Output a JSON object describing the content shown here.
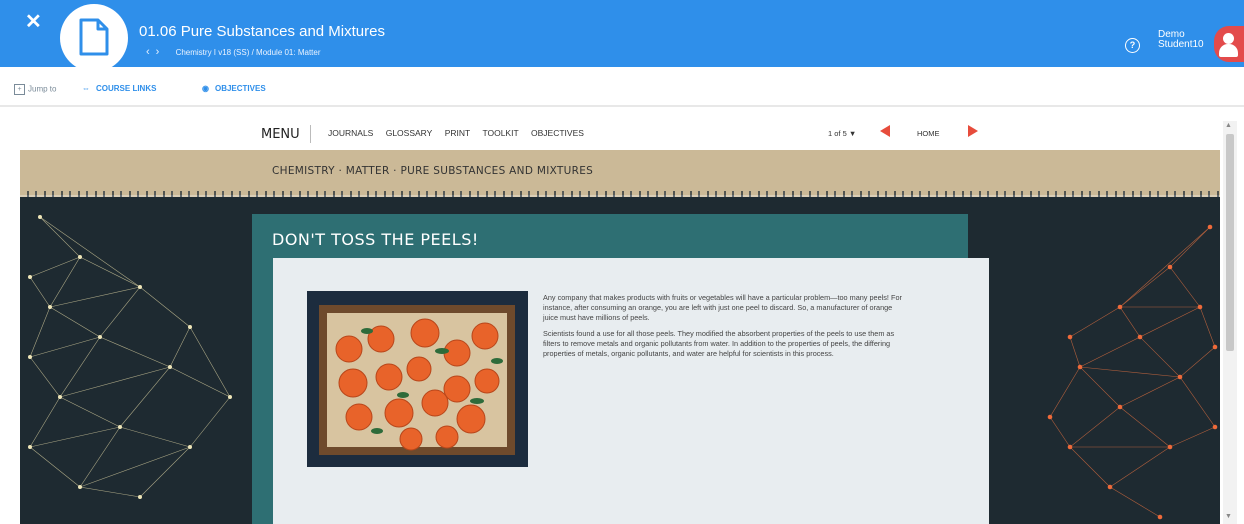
{
  "header": {
    "close_symbol": "✕",
    "title": "01.06 Pure Substances and Mixtures",
    "breadcrumb": "Chemistry I v18 (SS) / Module 01: Matter",
    "user_name": "Demo Student10",
    "doc_icon": "document-icon",
    "help_icon": "help-icon",
    "avatar_icon": "user-avatar"
  },
  "toolbar": {
    "jump_label": "Jump to",
    "course_links_label": "COURSE LINKS",
    "objectives_label": "OBJECTIVES"
  },
  "menu": {
    "menu_label": "MENU",
    "links": [
      "JOURNALS",
      "GLOSSARY",
      "PRINT",
      "TOOLKIT",
      "OBJECTIVES"
    ],
    "pager": "1 of 5 ▼",
    "home_label": "HOME"
  },
  "lesson": {
    "breadcrumb": "CHEMISTRY · MATTER · PURE SUBSTANCES AND MIXTURES",
    "panel_title": "DON'T TOSS THE PEELS!",
    "paragraph_1": "Any company that makes products with fruits or vegetables will have a particular problem—too many peels! For instance, after consuming an orange, you are left with just one peel to discard. So, a manufacturer of orange juice must have millions of peels.",
    "paragraph_2": "Scientists found a use for all those peels. They modified the absorbent properties of the peels to use them as filters to remove metals and organic pollutants from water. In addition to the properties of peels, the differing properties of metals, organic pollutants, and water are helpful for scientists in this process."
  },
  "colors": {
    "brand_blue": "#2f8fea",
    "teal": "#2e6f73",
    "dark_bg": "#1e2a31",
    "accent_red": "#e74c3c"
  }
}
